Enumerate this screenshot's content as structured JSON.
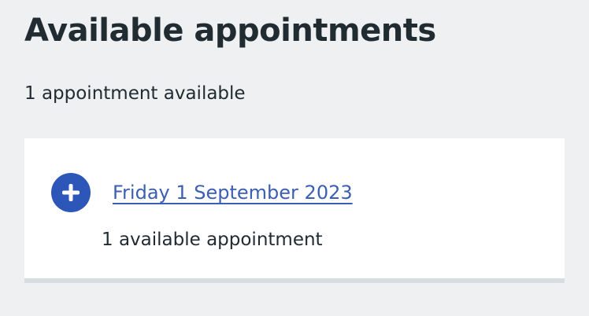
{
  "page": {
    "title": "Available appointments",
    "summary": "1 appointment available"
  },
  "days": [
    {
      "date_label": "Friday 1 September 2023",
      "count_label": "1 available appointment",
      "icon": "plus-circle-icon"
    }
  ],
  "colors": {
    "background": "#eef0f2",
    "card": "#ffffff",
    "icon_blue": "#2c56b8",
    "link_blue": "#3c5fb3",
    "text": "#212b32"
  }
}
